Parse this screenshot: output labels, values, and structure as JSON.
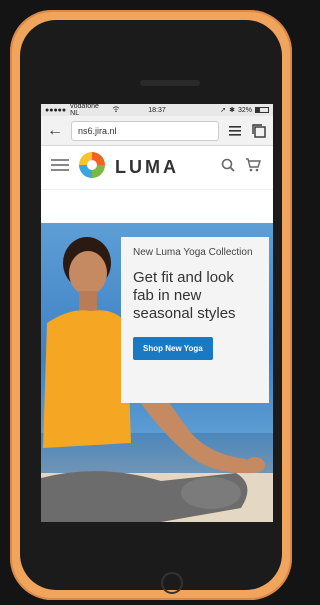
{
  "device": {
    "case_color": "#f1a45c",
    "phone_color": "#1b1b1b"
  },
  "status_bar": {
    "carrier": "vodafone NL",
    "time": "18:37",
    "battery_percent": "32%",
    "battery_level": 0.32,
    "icons": [
      "signal-dots-icon",
      "wifi-icon",
      "location-arrow-icon",
      "bluetooth-icon",
      "battery-icon"
    ]
  },
  "browser": {
    "url": "ns6.jira.nl",
    "icons": [
      "back-arrow-icon",
      "menu-lines-icon",
      "tabs-icon"
    ]
  },
  "site_header": {
    "logo_text": "LUMA",
    "icons": [
      "hamburger-menu-icon",
      "luma-logo-icon",
      "search-icon",
      "cart-icon"
    ]
  },
  "hero": {
    "kicker": "New Luma Yoga Collection",
    "headline": "Get fit and look fab in new seasonal styles",
    "cta_label": "Shop New Yoga",
    "cta_color": "#1979c3"
  }
}
